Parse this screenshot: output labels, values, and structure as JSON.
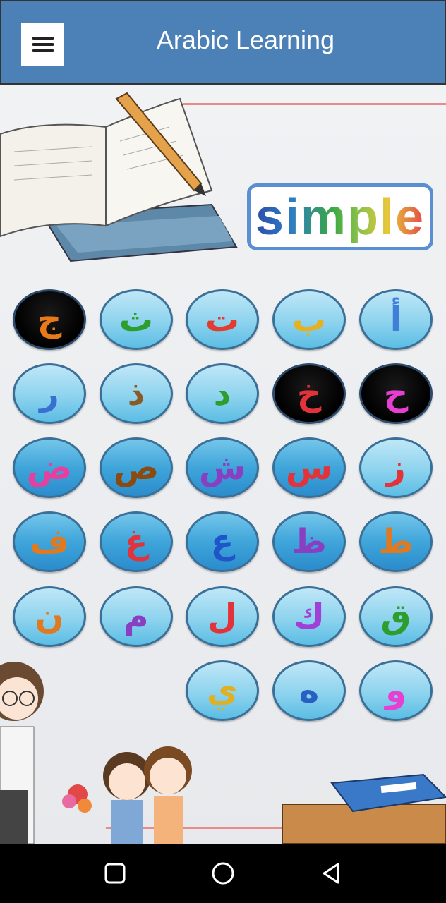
{
  "appbar": {
    "title": "Arabic Learning",
    "menu_icon": "hamburger-menu-icon",
    "bg_color": "#4c81b7"
  },
  "badge": {
    "text": "simple"
  },
  "letters": [
    {
      "char": "أ",
      "color": "#3f7fd8",
      "style": "light"
    },
    {
      "char": "ب",
      "color": "#e6b020",
      "style": "light"
    },
    {
      "char": "ت",
      "color": "#e23b2f",
      "style": "light"
    },
    {
      "char": "ث",
      "color": "#2d9e2d",
      "style": "light"
    },
    {
      "char": "ج",
      "color": "#e87a1a",
      "style": "dark"
    },
    {
      "char": "ح",
      "color": "#e63fd2",
      "style": "dark"
    },
    {
      "char": "خ",
      "color": "#e2323a",
      "style": "dark"
    },
    {
      "char": "د",
      "color": "#2d9e2d",
      "style": "light"
    },
    {
      "char": "ذ",
      "color": "#8a5a25",
      "style": "light"
    },
    {
      "char": "ر",
      "color": "#3a6fd2",
      "style": "light"
    },
    {
      "char": "ز",
      "color": "#e2323a",
      "style": "light"
    },
    {
      "char": "س",
      "color": "#e2323a",
      "style": "deep"
    },
    {
      "char": "ش",
      "color": "#8a3fc2",
      "style": "deep"
    },
    {
      "char": "ص",
      "color": "#8a4a10",
      "style": "deep"
    },
    {
      "char": "ض",
      "color": "#e63f9e",
      "style": "deep"
    },
    {
      "char": "ط",
      "color": "#e07a20",
      "style": "deep"
    },
    {
      "char": "ظ",
      "color": "#8a3fc2",
      "style": "deep"
    },
    {
      "char": "ع",
      "color": "#1f55c8",
      "style": "deep"
    },
    {
      "char": "غ",
      "color": "#e2323a",
      "style": "deep"
    },
    {
      "char": "ف",
      "color": "#e07a20",
      "style": "deep"
    },
    {
      "char": "ق",
      "color": "#2d9e2d",
      "style": "light"
    },
    {
      "char": "ك",
      "color": "#a040d8",
      "style": "light"
    },
    {
      "char": "ل",
      "color": "#e2323a",
      "style": "light"
    },
    {
      "char": "م",
      "color": "#8a3fc2",
      "style": "light"
    },
    {
      "char": "ن",
      "color": "#e07a20",
      "style": "light"
    },
    {
      "char": "و",
      "color": "#e63fd2",
      "style": "light"
    },
    {
      "char": "ه",
      "color": "#2a5fc2",
      "style": "light"
    },
    {
      "char": "ي",
      "color": "#e0b020",
      "style": "light"
    }
  ],
  "navbar": {
    "recents_icon": "recents-square-icon",
    "home_icon": "home-circle-icon",
    "back_icon": "back-triangle-icon"
  }
}
